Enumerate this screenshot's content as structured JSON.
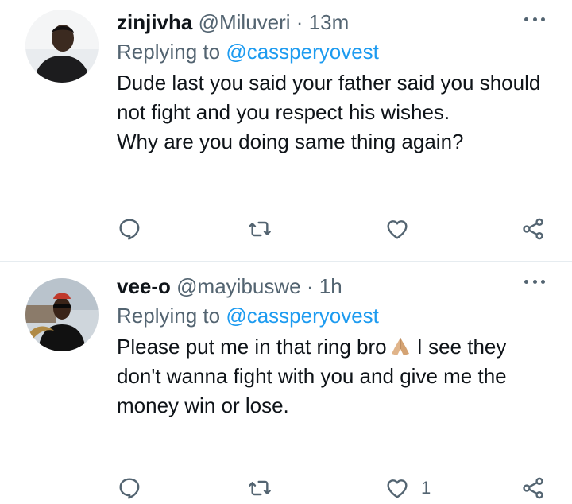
{
  "tweets": [
    {
      "name": "zinjivha",
      "handle": "@Miluveri",
      "separator": "·",
      "time": "13m",
      "replying_prefix": "Replying to",
      "replying_to": "@cassperyovest",
      "body_lines": [
        "Dude last you said your father said you should not fight and you respect his wishes.",
        "Why are you doing same thing again?"
      ],
      "like_count": ""
    },
    {
      "name": "vee-o",
      "handle": "@mayibuswe",
      "separator": "·",
      "time": "1h",
      "replying_prefix": "Replying to",
      "replying_to": "@cassperyovest",
      "body_before_emoji": "Please put me in that ring bro",
      "emoji": "folded-hands-emoji",
      "body_after_emoji": "I see they don't wanna fight with you and give me the money win or lose.",
      "like_count": "1"
    }
  ],
  "colors": {
    "text": "#0f1419",
    "secondary": "#536471",
    "link": "#1d9bf0",
    "divider": "#e6ecf0"
  },
  "icons": [
    "reply-icon",
    "retweet-icon",
    "like-icon",
    "share-icon",
    "more-icon"
  ]
}
